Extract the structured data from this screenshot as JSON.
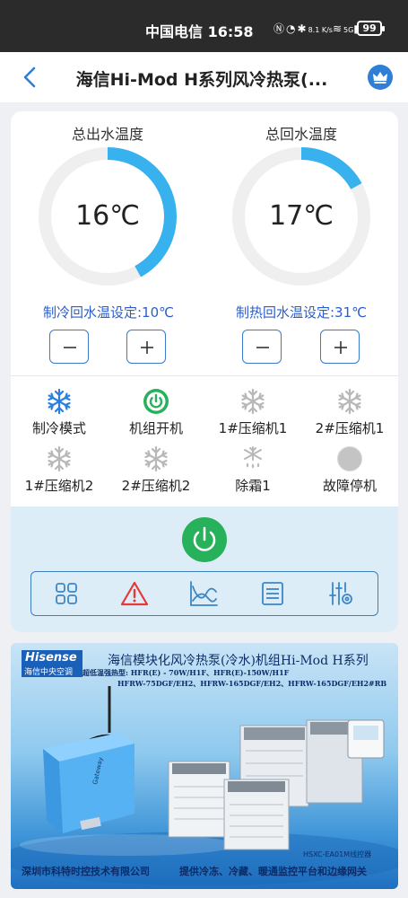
{
  "status_bar": {
    "carrier_time": "中国电信 16:58",
    "speed": "8.1 K/s",
    "network": "5G",
    "battery": "99"
  },
  "nav": {
    "title": "海信Hi-Mod H系列风冷热泵(..."
  },
  "gauges": [
    {
      "title": "总出水温度",
      "value": "16℃",
      "fill": 0.42
    },
    {
      "title": "总回水温度",
      "value": "17℃",
      "fill": 0.17
    }
  ],
  "setpoints": [
    {
      "label": "制冷回水温设定:10℃"
    },
    {
      "label": "制热回水温设定:31℃"
    }
  ],
  "status_items": [
    {
      "label": "制冷模式",
      "icon": "snowflake-icon",
      "state": "active"
    },
    {
      "label": "机组开机",
      "icon": "power-icon",
      "state": "on"
    },
    {
      "label": "1#压缩机1",
      "icon": "snowflake-icon",
      "state": "inactive"
    },
    {
      "label": "2#压缩机1",
      "icon": "snowflake-icon",
      "state": "inactive"
    },
    {
      "label": "1#压缩机2",
      "icon": "snowflake-icon",
      "state": "inactive"
    },
    {
      "label": "2#压缩机2",
      "icon": "snowflake-icon",
      "state": "inactive"
    },
    {
      "label": "除霜1",
      "icon": "defrost-icon",
      "state": "inactive"
    },
    {
      "label": "故障停机",
      "icon": "fault-indicator-icon",
      "state": "inactive"
    }
  ],
  "toolbar": [
    {
      "name": "grid-icon"
    },
    {
      "name": "alarm-icon"
    },
    {
      "name": "trend-chart-icon"
    },
    {
      "name": "list-icon"
    },
    {
      "name": "settings-sliders-icon"
    }
  ],
  "banner": {
    "logo_brand": "Hisense",
    "logo_sub": "海信中央空调",
    "title": "海信模块化风冷热泵(冷水)机组Hi-Mod H系列",
    "models": "超低温强热型: HFR(E) - 70W/H1F、HFR(E)-150W/H1F\n              HFRW-75DGF/EH2、HFRW-165DGF/EH2、HFRW-165DGF/EH2#RB",
    "controller": "HSXC-EA01M线控器",
    "company": "深圳市科特时控技术有限公司",
    "slogan": "提供冷冻、冷藏、暖通监控平台和边缘网关"
  },
  "colors": {
    "accent": "#2f7fd6",
    "gauge_track": "#efefef",
    "gauge_fill": "#38b2ee",
    "setpoint_text": "#2a5ecf",
    "power_on": "#26b15a",
    "alarm": "#e53935",
    "panel_bg": "#dcedf8"
  }
}
